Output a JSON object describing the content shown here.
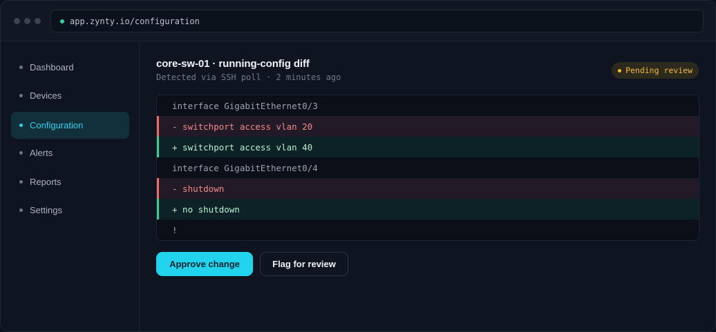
{
  "browser": {
    "url": "app.zynty.io/configuration"
  },
  "sidebar": {
    "items": [
      {
        "label": "Dashboard",
        "active": false
      },
      {
        "label": "Devices",
        "active": false
      },
      {
        "label": "Configuration",
        "active": true
      },
      {
        "label": "Alerts",
        "active": false
      },
      {
        "label": "Reports",
        "active": false
      },
      {
        "label": "Settings",
        "active": false
      }
    ]
  },
  "main": {
    "title": "core-sw-01 · running-config diff",
    "subtitle": "Detected via SSH poll · 2 minutes ago",
    "status_badge": "Pending review",
    "diff": [
      {
        "type": "ctx",
        "text": "interface GigabitEthernet0/3"
      },
      {
        "type": "del",
        "text": "- switchport access vlan 20"
      },
      {
        "type": "add",
        "text": "+ switchport access vlan 40"
      },
      {
        "type": "ctx",
        "text": "interface GigabitEthernet0/4"
      },
      {
        "type": "del",
        "text": "- shutdown"
      },
      {
        "type": "add",
        "text": "+ no shutdown"
      },
      {
        "type": "ctx",
        "text": "!"
      }
    ],
    "actions": {
      "approve_label": "Approve change",
      "flag_label": "Flag for review"
    }
  },
  "colors": {
    "accent": "#22d3ee",
    "pending": "#fbbf24",
    "added": "#34d399",
    "removed": "#ef6b6b"
  }
}
